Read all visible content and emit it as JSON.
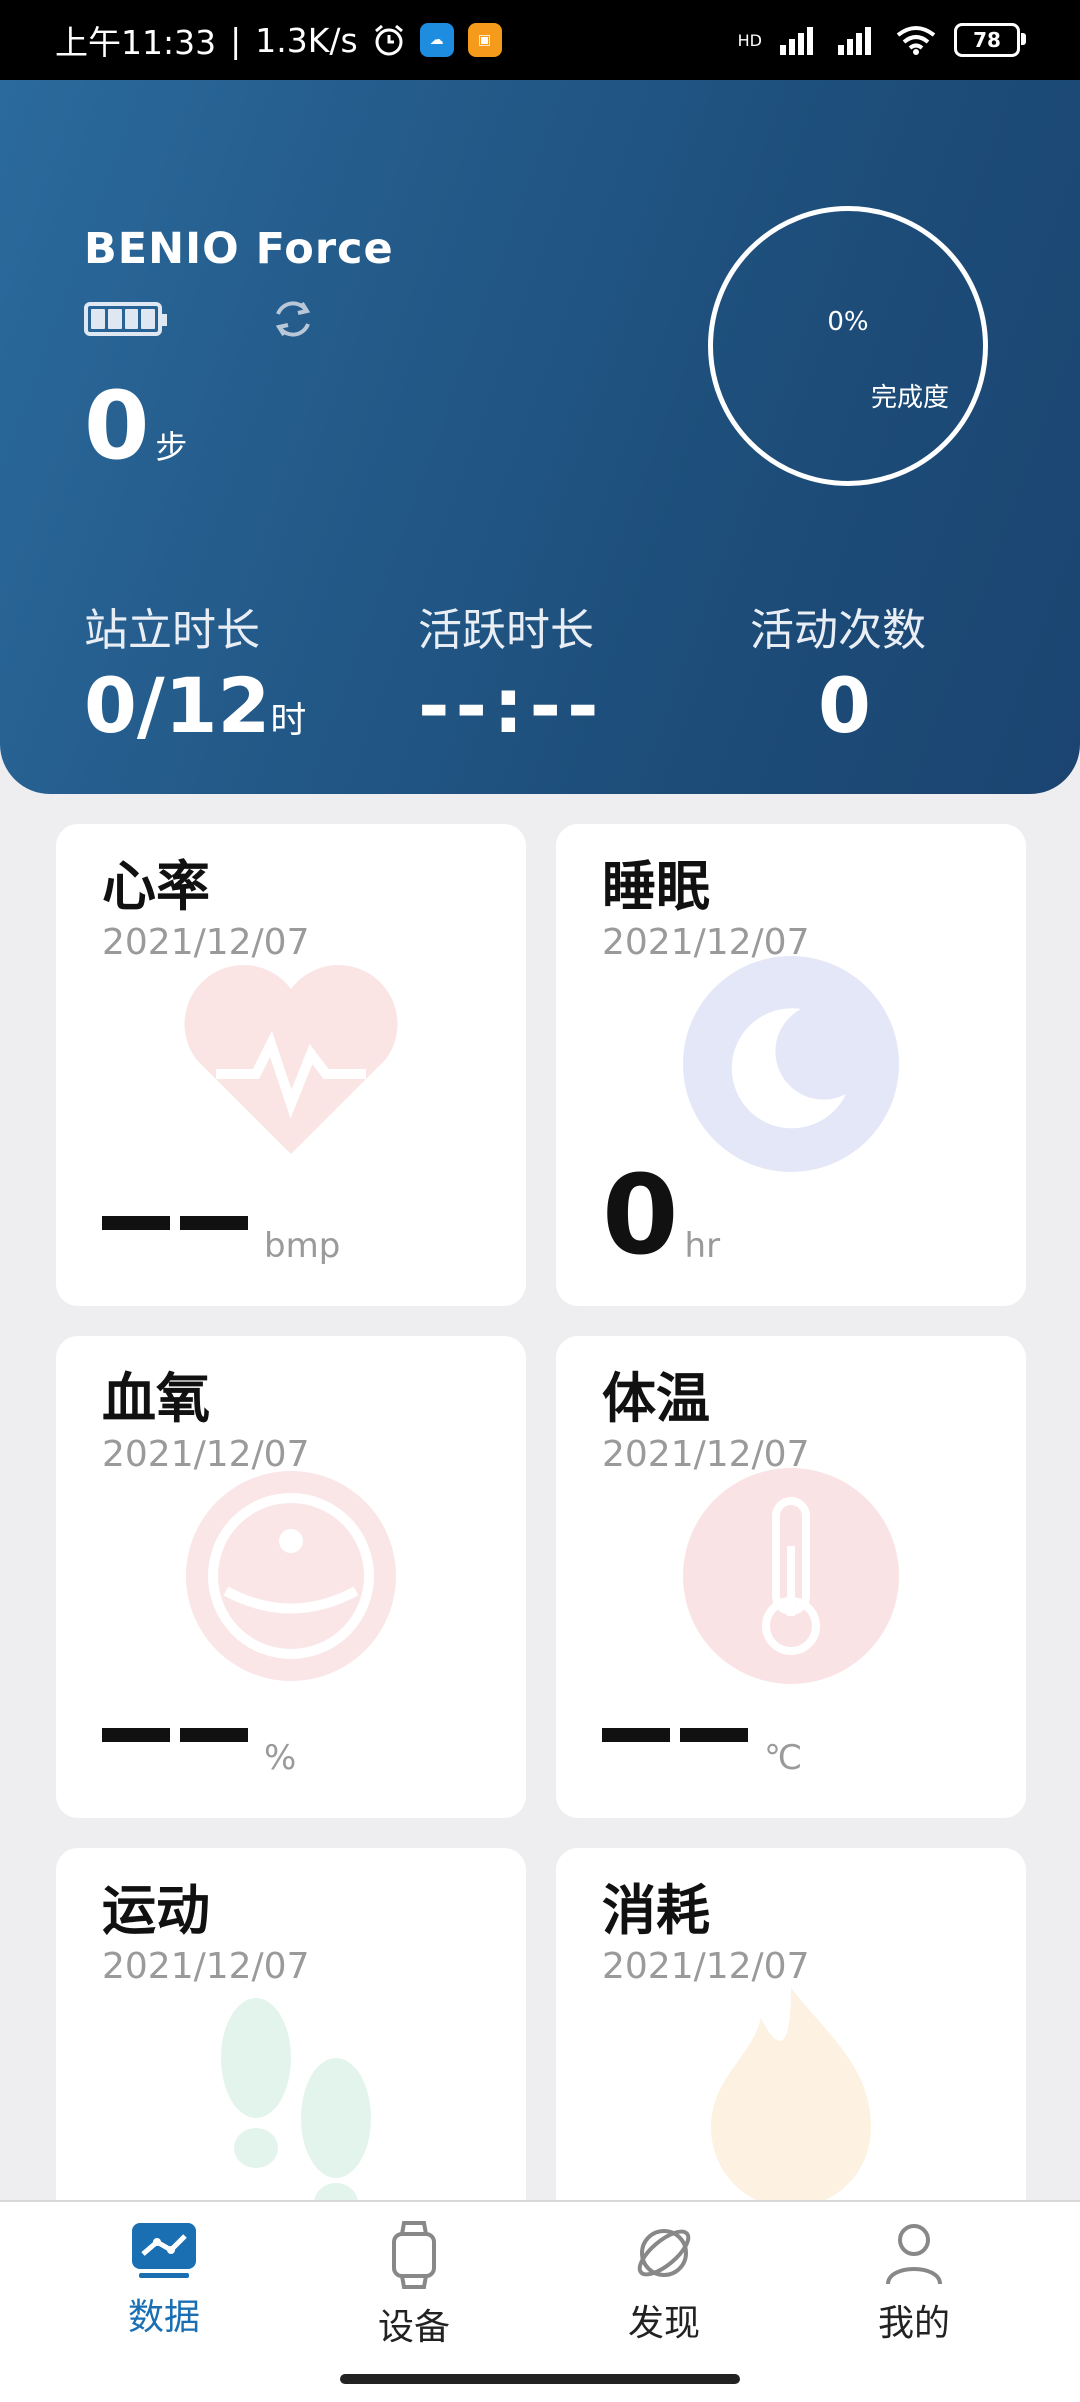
{
  "status_bar": {
    "time": "上午11:33",
    "speed": "1.3K/s",
    "network": "HD",
    "battery": "78"
  },
  "header": {
    "device_name": "BENIO Force",
    "steps_value": "0",
    "steps_unit": "步",
    "completion_percent": "0%",
    "completion_label": "完成度",
    "metrics": [
      {
        "label": "站立时长",
        "value": "0/12",
        "unit": "时"
      },
      {
        "label": "活跃时长",
        "value": "--:--",
        "unit": ""
      },
      {
        "label": "活动次数",
        "value": "0",
        "unit": ""
      }
    ]
  },
  "cards": [
    {
      "title": "心率",
      "date": "2021/12/07",
      "value": "",
      "unit": "bmp",
      "icon": "heart-icon",
      "color": "#e03a3a"
    },
    {
      "title": "睡眠",
      "date": "2021/12/07",
      "value": "0",
      "unit": "hr",
      "icon": "moon-icon",
      "color": "#3b4fd1"
    },
    {
      "title": "血氧",
      "date": "2021/12/07",
      "value": "",
      "unit": "%",
      "icon": "blood-oxygen-icon",
      "color": "#e04a4a"
    },
    {
      "title": "体温",
      "date": "2021/12/07",
      "value": "",
      "unit": "℃",
      "icon": "thermometer-icon",
      "color": "#e0303a"
    },
    {
      "title": "运动",
      "date": "2021/12/07",
      "value": "",
      "unit": "",
      "icon": "footprints-icon",
      "color": "#2bb36a"
    },
    {
      "title": "消耗",
      "date": "2021/12/07",
      "value": "",
      "unit": "",
      "icon": "flame-icon",
      "color": "#f0a020"
    }
  ],
  "bottom_nav": [
    {
      "label": "数据",
      "icon": "data-icon",
      "active": true
    },
    {
      "label": "设备",
      "icon": "watch-icon",
      "active": false
    },
    {
      "label": "发现",
      "icon": "discover-icon",
      "active": false
    },
    {
      "label": "我的",
      "icon": "profile-icon",
      "active": false
    }
  ],
  "colors": {
    "header_start": "#2b6a9d",
    "header_end": "#1b4471",
    "accent": "#1a6fb3"
  }
}
